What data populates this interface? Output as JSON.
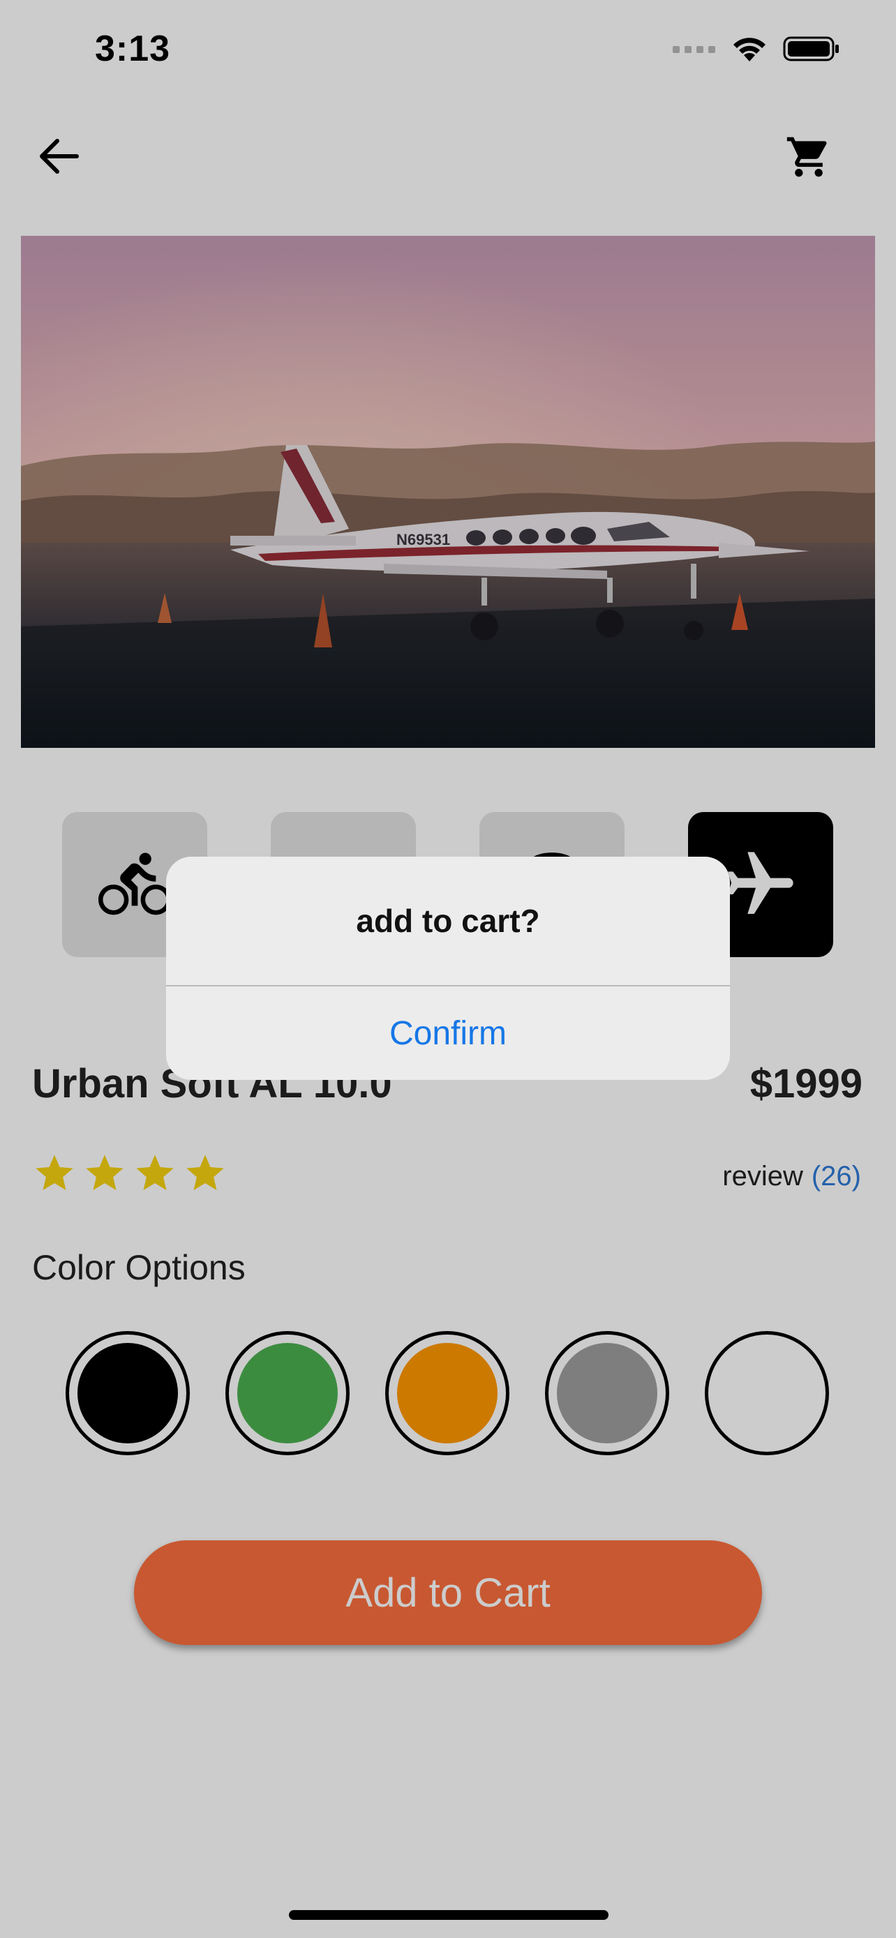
{
  "status_bar": {
    "time": "3:13"
  },
  "product": {
    "name": "Urban Soft AL 10.0",
    "price": "$1999",
    "rating_stars": 4,
    "review_label": "review",
    "review_count": "(26)"
  },
  "colors_section": {
    "title": "Color Options",
    "swatches": [
      "#000000",
      "#4caf50",
      "#ff9800",
      "#9e9e9e",
      "#ffffff"
    ]
  },
  "thumbnails": [
    {
      "icon": "bicycle-icon",
      "selected": false
    },
    {
      "icon": "thumbnail-icon",
      "selected": false
    },
    {
      "icon": "thumbnail-icon",
      "selected": false
    },
    {
      "icon": "airplane-icon",
      "selected": true
    }
  ],
  "actions": {
    "add_to_cart": "Add to Cart"
  },
  "dialog": {
    "title": "add to cart?",
    "confirm": "Confirm"
  },
  "theme": {
    "accent": "#fb6f3e",
    "link": "#1677e6",
    "star": "#f5d10f"
  }
}
